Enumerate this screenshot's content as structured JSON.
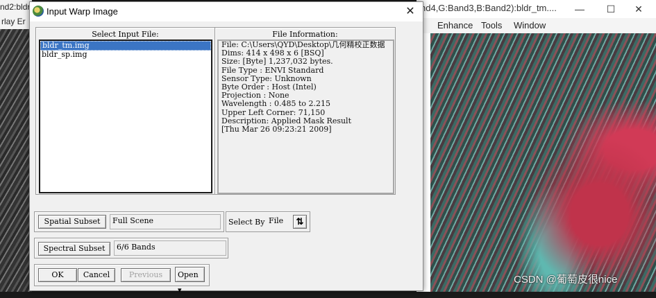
{
  "background_left": {
    "title": "nd2:bldr_tm.img",
    "menu": "rlay   Er"
  },
  "background_right": {
    "title": "nd4,G:Band3,B:Band2):bldr_tm....",
    "menu": [
      "Enhance",
      "Tools",
      "Window"
    ],
    "minimize": "—",
    "maximize": "☐",
    "close": "✕"
  },
  "watermark": "CSDN @葡萄皮很nice",
  "dialog": {
    "title": "Input Warp Image",
    "close": "✕",
    "input_file_label": "Select Input File:",
    "files": [
      "bldr_tm.img",
      "bldr_sp.img"
    ],
    "file_info_label": "File Information:",
    "file_info": [
      "File: C:\\Users\\QYD\\Desktop\\几何精校正数据",
      "Dims: 414 x 498 x 6 [BSQ]",
      "Size: [Byte] 1,237,032 bytes.",
      "File Type  : ENVI Standard",
      "Sensor Type: Unknown",
      "Byte Order : Host (Intel)",
      "Projection : None",
      "Wavelength : 0.485 to 2.215",
      "Upper Left Corner: 71,150",
      "Description: Applied Mask Result",
      "[Thu Mar 26 09:23:21 2009]"
    ],
    "spatial_subset_label": "Spatial Subset",
    "spatial_subset_value": "Full Scene",
    "select_by_label": "Select By",
    "select_by_value": "File",
    "sort_glyph": "⇅",
    "spectral_subset_label": "Spectral Subset",
    "spectral_subset_value": "6/6 Bands",
    "ok": "OK",
    "cancel": "Cancel",
    "previous": "Previous",
    "open": "Open",
    "open_arrow": "▾"
  }
}
